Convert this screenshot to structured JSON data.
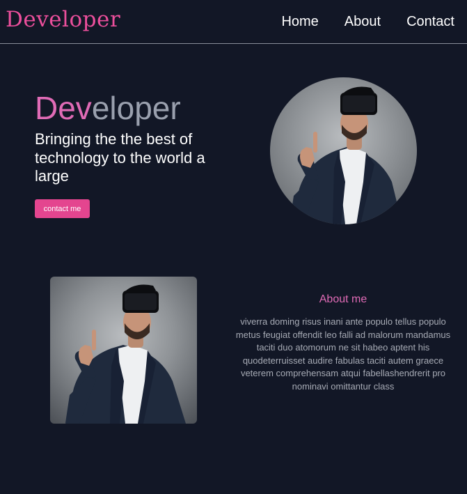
{
  "header": {
    "logo": "Developer",
    "nav": {
      "home": "Home",
      "about": "About",
      "contact": "Contact"
    }
  },
  "hero": {
    "title_accent": "Dev",
    "title_rest": "eloper",
    "subtitle": "Bringing the the best of technology to the world a large",
    "cta": "contact me"
  },
  "about": {
    "title": "About me",
    "body": "viverra doming risus inani ante populo tellus populo metus feugiat offendit leo falli ad malorum mandamus taciti duo atomorum ne sit habeo aptent his quodeterruisset audire fabulas taciti autem graece veterem comprehensam atqui fabellashendrerit pro nominavi omittantur class"
  },
  "colors": {
    "background": "#121726",
    "accent": "#e4458f",
    "accent_text": "#e06bb6",
    "muted_text": "#9aa0ae"
  }
}
